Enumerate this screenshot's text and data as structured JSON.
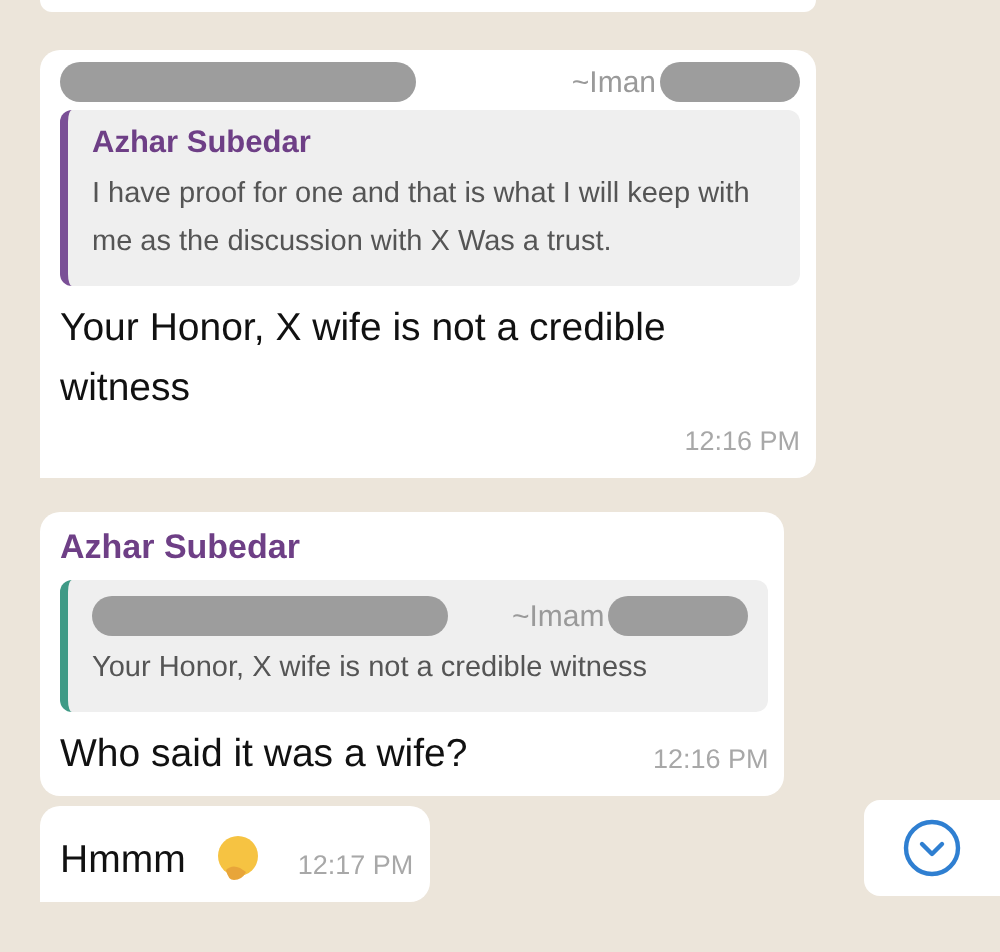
{
  "messages": [
    {
      "kind": "reply",
      "header": {
        "kind": "redacted",
        "label": "~Iman"
      },
      "quote": {
        "author": {
          "kind": "name",
          "label": "Azhar Subedar"
        },
        "text": "I have proof for one and that is what I will keep with me as the discussion with X Was a trust.",
        "color": "#7a4f96"
      },
      "text": "Your Honor, X wife is not a credible witness",
      "time": "12:16 PM",
      "tail": true
    },
    {
      "kind": "reply",
      "header": {
        "kind": "name",
        "label": "Azhar Subedar"
      },
      "quote": {
        "author": {
          "kind": "redacted",
          "label": "~Imam"
        },
        "text": "Your Honor, X wife is not a credible witness",
        "color": "#3f9a86"
      },
      "text": "Who said it was a wife?",
      "time": "12:16 PM",
      "tail": false
    },
    {
      "kind": "plain",
      "text": "Hmmm",
      "emoji": true,
      "time": "12:17 PM",
      "tail": true
    }
  ]
}
